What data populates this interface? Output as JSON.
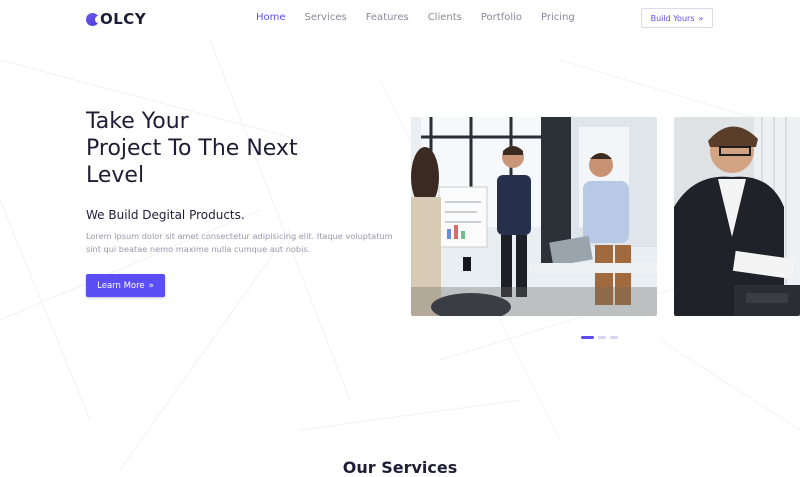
{
  "brand": {
    "logo_text": "OLCY",
    "icon": "logo-circle-icon",
    "accent": "#5b4ef5"
  },
  "nav": {
    "items": [
      {
        "label": "Home",
        "active": true
      },
      {
        "label": "Services",
        "active": false
      },
      {
        "label": "Features",
        "active": false
      },
      {
        "label": "Clients",
        "active": false
      },
      {
        "label": "Portfolio",
        "active": false
      },
      {
        "label": "Pricing",
        "active": false
      }
    ],
    "cta_label": "Build Yours",
    "cta_icon": "double-chevron-right-icon"
  },
  "hero": {
    "title_lines": [
      "Take Your",
      "Project To The Next",
      "Level"
    ],
    "subtitle": "We Build Degital Products.",
    "description": "Lorem ipsum dolor sit amet consectetur adipisicing elit. Itaque voluptatum sint qui beatae nemo maxime nulla cumque aut nobis.",
    "button_label": "Learn More",
    "button_icon": "double-chevron-right-icon"
  },
  "slider": {
    "images": [
      {
        "description": "team-meeting-photo"
      },
      {
        "description": "businessman-at-desk-photo"
      }
    ],
    "dots": 3,
    "active_dot": 0
  },
  "services": {
    "title": "Our Services"
  },
  "colors": {
    "text": "#1f1d36",
    "muted": "#9a97ab",
    "primary": "#5b4ef5"
  }
}
